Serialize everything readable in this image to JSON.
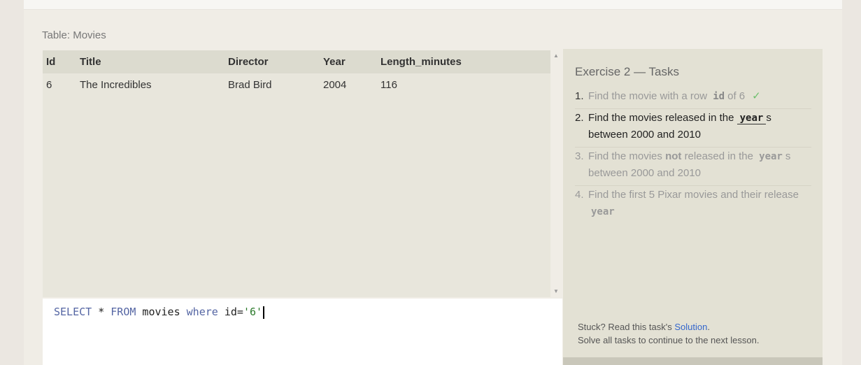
{
  "table_label": "Table: Movies",
  "columns": [
    "Id",
    "Title",
    "Director",
    "Year",
    "Length_minutes"
  ],
  "rows": [
    [
      "6",
      "The Incredibles",
      "Brad Bird",
      "2004",
      "116"
    ]
  ],
  "editor": {
    "kw1": "SELECT",
    "star": " * ",
    "kw2": "FROM",
    "table": " movies ",
    "kw3": "where",
    "cond": " id=",
    "value": "'6'"
  },
  "scroll": {
    "up": "▲",
    "down": "▼"
  },
  "exercise": {
    "title": "Exercise 2 — Tasks",
    "tasks": [
      {
        "num": "1.",
        "pre": "Find the movie with a row",
        "code": "id",
        "post": "of 6",
        "check": "✓"
      },
      {
        "num": "2.",
        "pre": "Find the movies released in the",
        "code": "year",
        "post": "s between 2000 and 2010"
      },
      {
        "num": "3.",
        "pre": "Find the movies",
        "bold": "not",
        "mid": "released in the",
        "code": "year",
        "post": "s between 2000 and 2010"
      },
      {
        "num": "4.",
        "pre": "Find the first 5 Pixar movies and their release",
        "code": "year"
      }
    ],
    "footer_prefix": "Stuck? Read this task's ",
    "footer_link": "Solution",
    "footer_suffix": ".",
    "footer_line2": "Solve all tasks to continue to the next lesson."
  }
}
